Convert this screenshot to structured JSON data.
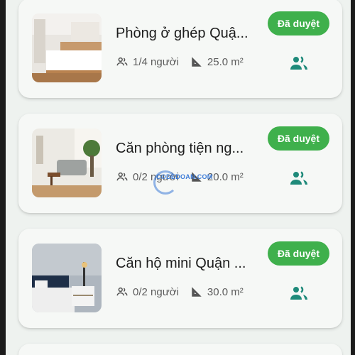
{
  "rooms": [
    {
      "title": "Phòng ở ghép Quậ...",
      "occupancy": "1/4 người",
      "area": "25.0 m²",
      "status": "Đã duyệt",
      "image": "bedroom-photo"
    },
    {
      "title": "Căn phòng tiện ng...",
      "occupancy": "0/2 người",
      "area": "20.0 m²",
      "status": "Đã duyệt",
      "image": "living-room-photo"
    },
    {
      "title": "Căn hộ mini Quận ...",
      "occupancy": "0/2 người",
      "area": "30.0 m²",
      "status": "Đã duyệt",
      "image": "bedroom-lamp-photo"
    }
  ],
  "watermark": "CODEDOAN.COM",
  "colors": {
    "accent": "#1f8a7a",
    "badge": "#3fb04c",
    "card": "#f6f8f6",
    "background": "#eef2ef"
  }
}
